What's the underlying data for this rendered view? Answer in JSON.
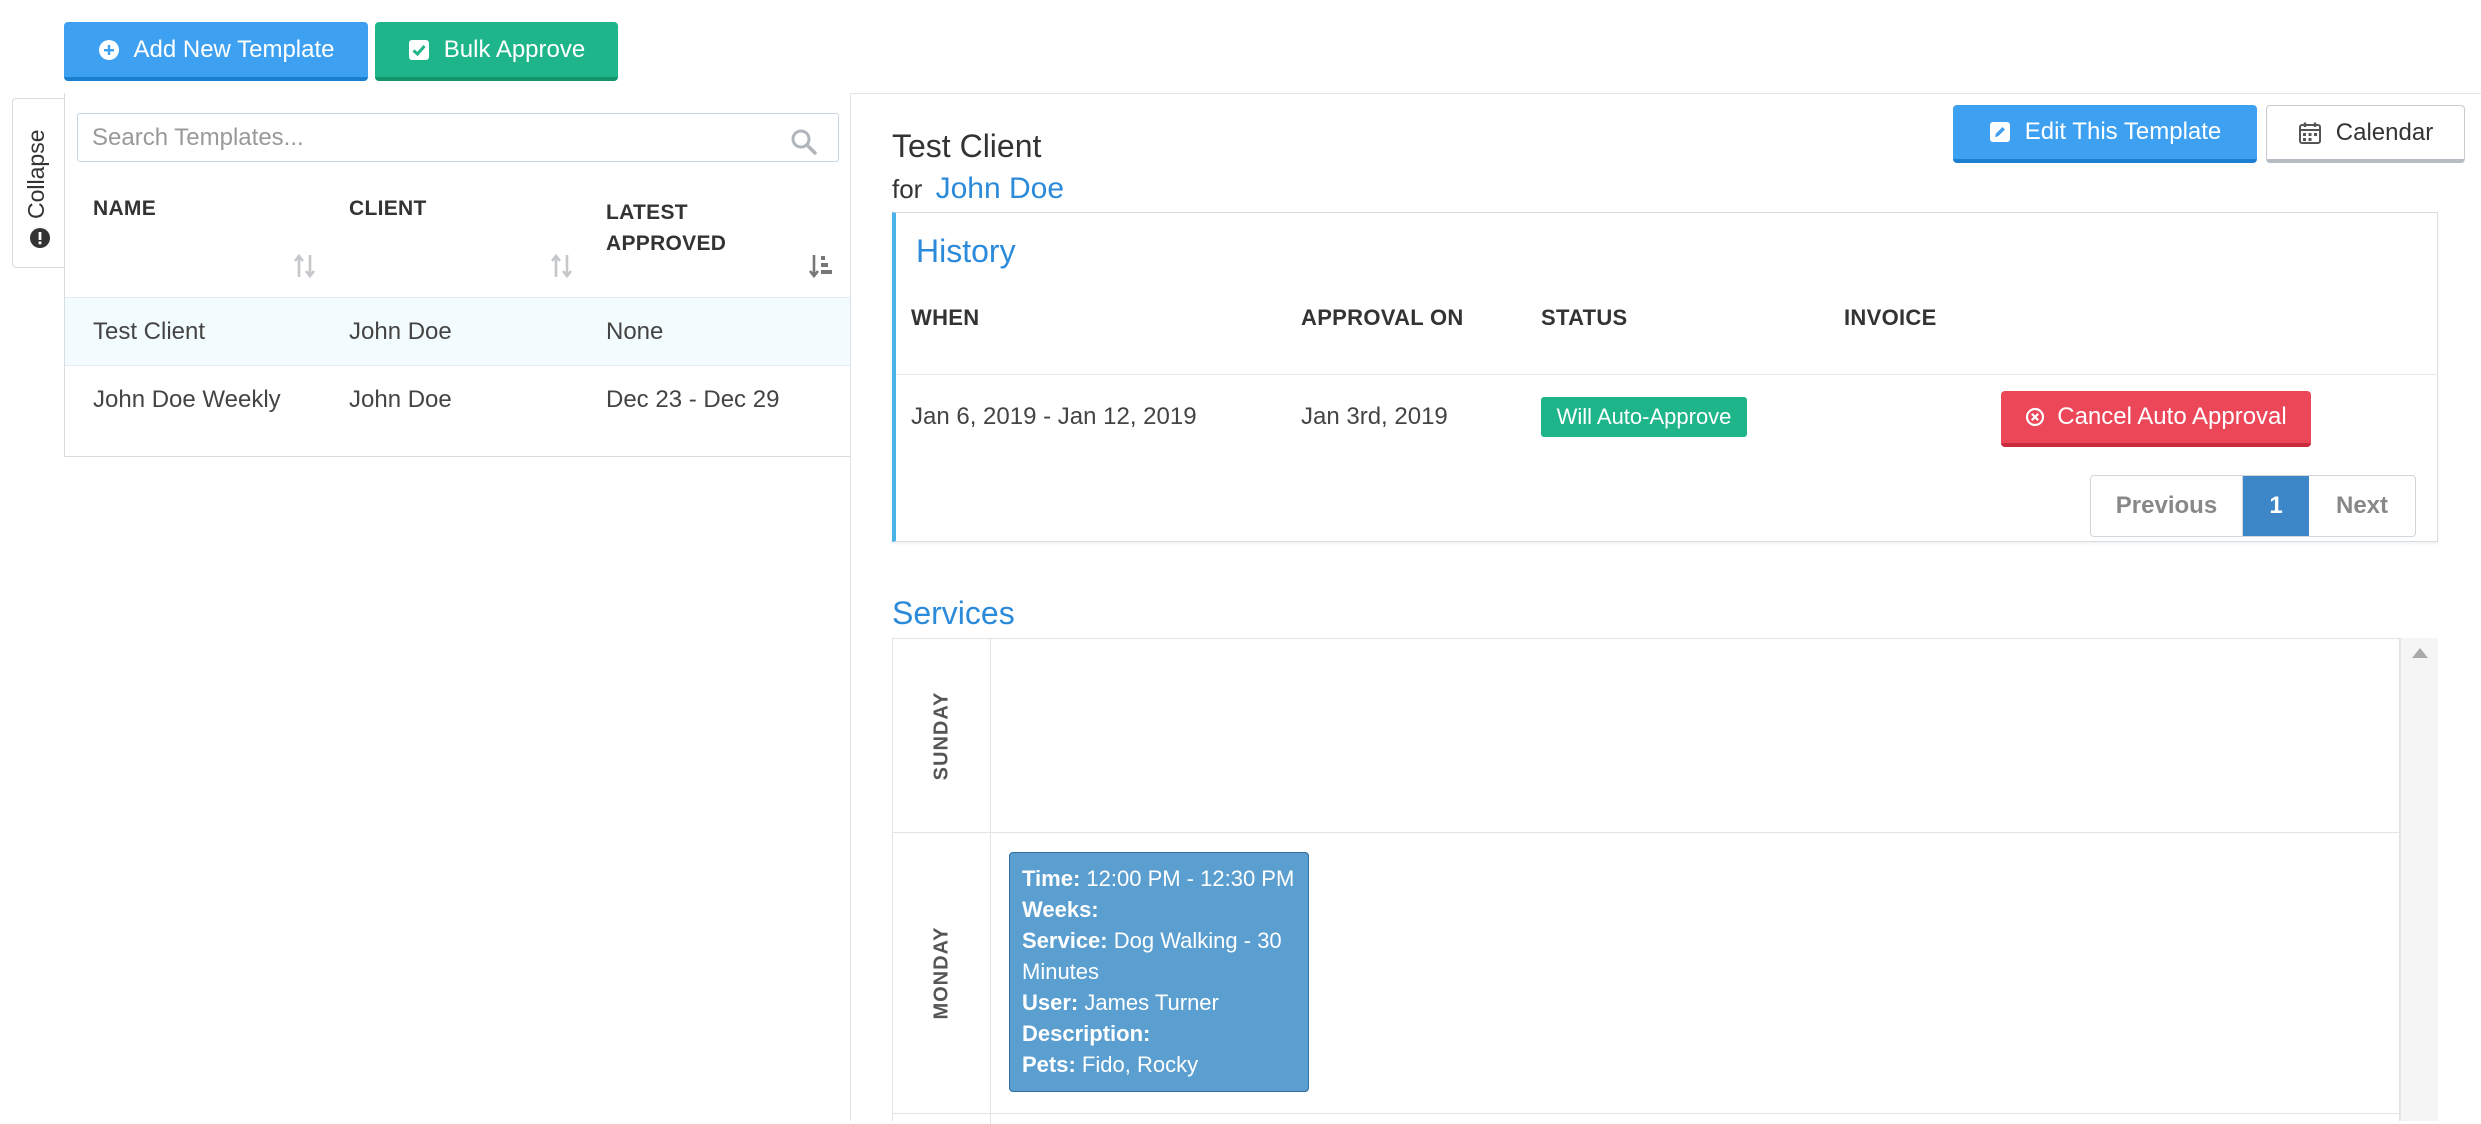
{
  "toolbar": {
    "add_template": "Add New Template",
    "bulk_approve": "Bulk Approve"
  },
  "collapse_label": "Collapse",
  "search": {
    "placeholder": "Search Templates..."
  },
  "templates_table": {
    "headers": {
      "name": "NAME",
      "client": "CLIENT",
      "latest_approved_line1": "LATEST",
      "latest_approved_line2": "APPROVED"
    },
    "rows": [
      {
        "name": "Test Client",
        "client": "John Doe",
        "latest": "None"
      },
      {
        "name": "John Doe Weekly",
        "client": "John Doe",
        "latest": "Dec 23 - Dec 29"
      }
    ]
  },
  "detail": {
    "title": "Test Client",
    "for_prefix": "for",
    "client_link": "John Doe",
    "edit_button": "Edit This Template",
    "calendar_button": "Calendar"
  },
  "history": {
    "title": "History",
    "headers": {
      "when": "WHEN",
      "approval_on": "APPROVAL ON",
      "status": "STATUS",
      "invoice": "INVOICE"
    },
    "rows": [
      {
        "when": "Jan 6, 2019 - Jan 12, 2019",
        "approval_on": "Jan 3rd, 2019",
        "status": "Will Auto-Approve",
        "action": "Cancel Auto Approval"
      }
    ],
    "pagination": {
      "previous": "Previous",
      "current": "1",
      "next": "Next"
    }
  },
  "services": {
    "title": "Services",
    "days": [
      "SUNDAY",
      "MONDAY"
    ],
    "event": {
      "time_label": "Time:",
      "time": "12:00 PM - 12:30 PM",
      "weeks_label": "Weeks:",
      "service_label": "Service:",
      "service_line1": "Dog Walking - 30",
      "service_line2": "Minutes",
      "user_label": "User:",
      "user": "James Turner",
      "description_label": "Description:",
      "pets_label": "Pets:",
      "pets": "Fido, Rocky"
    }
  },
  "colors": {
    "primary": "#3ea0f0",
    "success": "#1fb58a",
    "danger": "#ec4659",
    "link": "#2b8ad9",
    "event": "#5a9fd0"
  },
  "icons": [
    "plus-circle-icon",
    "check-square-icon",
    "search-icon",
    "sort-icon",
    "sort-amount-icon",
    "info-circle-icon",
    "edit-icon",
    "calendar-icon",
    "times-circle-icon",
    "scroll-up-icon"
  ]
}
